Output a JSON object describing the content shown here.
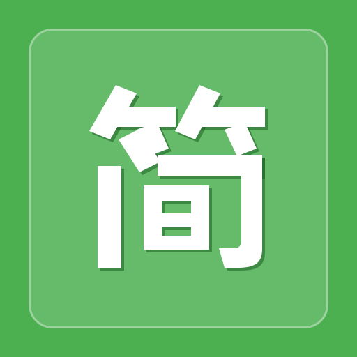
{
  "icon": {
    "character": "简",
    "colors": {
      "background": "#4caf50",
      "tile": "#66bb6a",
      "tile_border": "#a5d6a7",
      "glyph": "#ffffff",
      "glyph_shadow": "#1b5e20"
    }
  }
}
